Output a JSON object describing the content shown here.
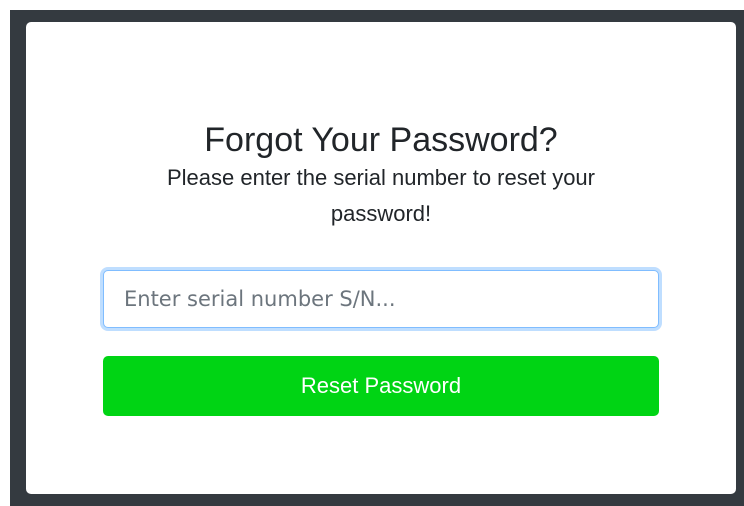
{
  "dialog": {
    "title": "Forgot Your Password?",
    "message": "Please enter the serial number to reset your password!",
    "serial_input": {
      "value": "",
      "placeholder": "Enter serial number S/N..."
    },
    "reset_button_label": "Reset Password"
  },
  "colors": {
    "backdrop": "#343a40",
    "card": "#ffffff",
    "button": "#00d414",
    "button_text": "#ffffff",
    "input_focus_border": "#80bdff"
  }
}
